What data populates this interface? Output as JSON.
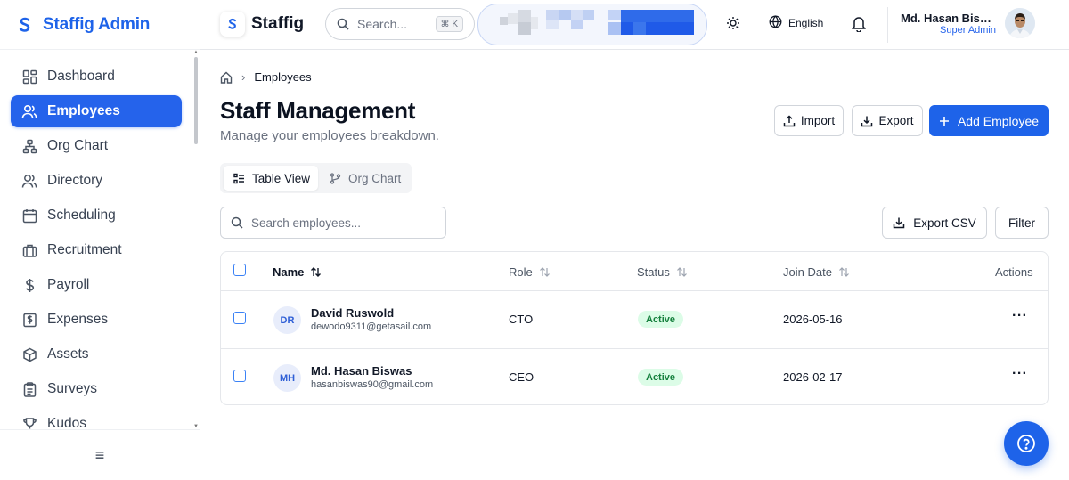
{
  "app": {
    "brand": "Staffig Admin"
  },
  "sidebar": {
    "items": [
      {
        "label": "Dashboard",
        "icon": "dashboard-icon"
      },
      {
        "label": "Employees",
        "icon": "users-icon",
        "active": true
      },
      {
        "label": "Org Chart",
        "icon": "org-chart-icon"
      },
      {
        "label": "Directory",
        "icon": "directory-icon"
      },
      {
        "label": "Scheduling",
        "icon": "calendar-icon"
      },
      {
        "label": "Recruitment",
        "icon": "briefcase-icon"
      },
      {
        "label": "Payroll",
        "icon": "dollar-icon"
      },
      {
        "label": "Expenses",
        "icon": "receipt-icon"
      },
      {
        "label": "Assets",
        "icon": "box-icon"
      },
      {
        "label": "Surveys",
        "icon": "clipboard-icon"
      },
      {
        "label": "Kudos",
        "icon": "trophy-icon"
      }
    ],
    "menu_icon": "≡"
  },
  "topbar": {
    "brand": "Staffig",
    "search_placeholder": "Search...",
    "shortcut": "⌘ K",
    "language": "English",
    "user": {
      "name": "Md. Hasan Biswas",
      "role": "Super Admin"
    }
  },
  "page": {
    "breadcrumb": "Employees",
    "title": "Staff Management",
    "subtitle": "Manage your employees breakdown.",
    "import_label": "Import",
    "export_label": "Export",
    "add_label": "Add Employee",
    "views": {
      "table": "Table View",
      "org": "Org Chart"
    },
    "search_placeholder": "Search employees...",
    "export_csv_label": "Export CSV",
    "filter_label": "Filter"
  },
  "table": {
    "headers": {
      "name": "Name",
      "role": "Role",
      "status": "Status",
      "join_date": "Join Date",
      "actions": "Actions"
    },
    "rows": [
      {
        "initials": "DR",
        "name": "David Ruswold",
        "email": "dewodo9311@getasail.com",
        "role": "CTO",
        "status": "Active",
        "join_date": "2026-05-16",
        "actions": "···"
      },
      {
        "initials": "MH",
        "name": "Md. Hasan Biswas",
        "email": "hasanbiswas90@gmail.com",
        "role": "CEO",
        "status": "Active",
        "join_date": "2026-02-17",
        "actions": "···"
      }
    ]
  },
  "colors": {
    "accent": "#1e63e9",
    "status_active_bg": "#dcfce7",
    "status_active_fg": "#15803d"
  }
}
